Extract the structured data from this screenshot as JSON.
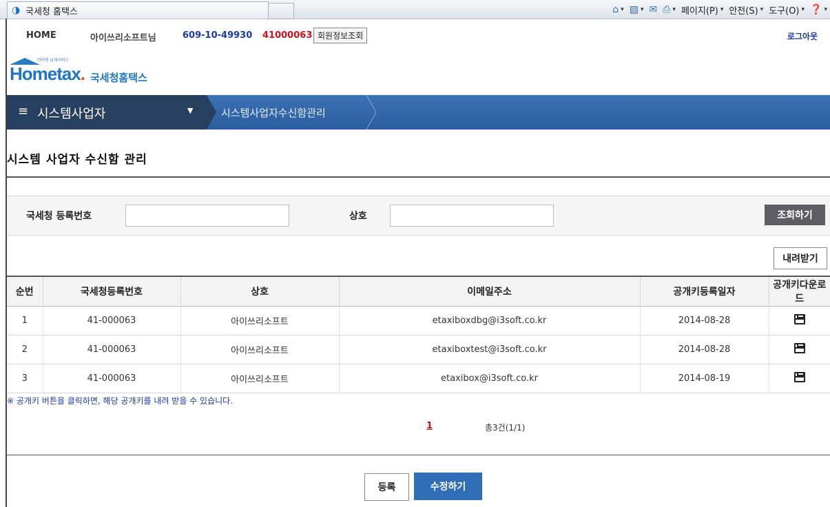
{
  "browser": {
    "tab_title": "국세청 홈택스",
    "tools": [
      {
        "icon": "home-icon",
        "label": ""
      },
      {
        "icon": "rss-icon",
        "label": ""
      },
      {
        "icon": "mail-icon",
        "label": ""
      },
      {
        "icon": "print-icon",
        "label": ""
      },
      {
        "icon": "page-menu",
        "label": "페이지(P)"
      },
      {
        "icon": "safety-menu",
        "label": "안전(S)"
      },
      {
        "icon": "tools-menu",
        "label": "도구(O)"
      },
      {
        "icon": "help-icon",
        "label": ""
      }
    ]
  },
  "topbar": {
    "home": "HOME",
    "user": "아이쓰리소프트님",
    "bizno": "609-10-49930",
    "code": "41000063",
    "member_info_button": "회원정보조회",
    "logout": "로그아웃"
  },
  "logo": {
    "tagline": "인터넷 납세서비스",
    "brand_a": "Hom",
    "brand_e": "e",
    "brand_b": "tax",
    "brand_dot": ".",
    "brand_kr": "국세청홈택스"
  },
  "nav": {
    "menu_label": "시스템사업자",
    "breadcrumb": "시스템사업자수신함관리"
  },
  "page": {
    "title": "시스템 사업자 수신함 관리"
  },
  "search": {
    "reg_no_label": "국세청 등록번호",
    "reg_no_value": "",
    "company_label": "상호",
    "company_value": "",
    "submit": "조회하기"
  },
  "download_button": "내려받기",
  "table": {
    "headers": [
      "순번",
      "국세청등록번호",
      "상호",
      "이메일주소",
      "공개키등록일자",
      "공개키다운로드"
    ],
    "rows": [
      {
        "no": "1",
        "reg_no": "41-000063",
        "company": "아이쓰리소프트",
        "email": "etaxiboxdbg@i3soft.co.kr",
        "date": "2014-08-28"
      },
      {
        "no": "2",
        "reg_no": "41-000063",
        "company": "아이쓰리소프트",
        "email": "etaxiboxtest@i3soft.co.kr",
        "date": "2014-08-28"
      },
      {
        "no": "3",
        "reg_no": "41-000063",
        "company": "아이쓰리소프트",
        "email": "etaxibox@i3soft.co.kr",
        "date": "2014-08-19"
      }
    ]
  },
  "note": "※ 공개키 버튼을 클릭하면, 해당 공개키를 내려 받을 수 있습니다.",
  "pagination": {
    "current_page": "1",
    "total": "총3건(1/1)"
  },
  "footer_buttons": {
    "register": "등록",
    "edit": "수정하기"
  },
  "colors": {
    "nav_blue": "#2f66ab",
    "nav_dark": "#27405f",
    "brand_blue": "#1f76c4",
    "accent_red": "#d0101a",
    "button_blue": "#2f6db6"
  }
}
